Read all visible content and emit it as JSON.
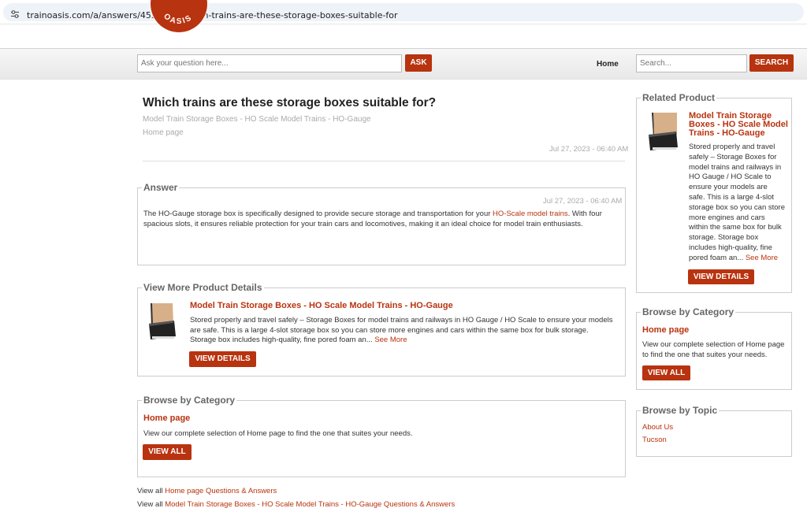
{
  "browser": {
    "url": "trainoasis.com/a/answers/4538511/Which-trains-are-these-storage-boxes-suitable-for"
  },
  "logo": {
    "text": "OASIS",
    "color": "#b8330f"
  },
  "header": {
    "ask_placeholder": "Ask your question here...",
    "ask_label": "ASK",
    "home_label": "Home",
    "search_placeholder": "Search...",
    "search_label": "SEARCH"
  },
  "question": {
    "title": "Which trains are these storage boxes suitable for",
    "title_suffix": "?",
    "breadcrumb": "Model Train Storage Boxes - HO Scale Model Trains - HO-Gauge",
    "home": "Home page",
    "date": "Jul 27, 2023 - 06:40 AM"
  },
  "answer": {
    "legend": "Answer",
    "date": "Jul 27, 2023 - 06:40 AM",
    "text_before": "The HO-Gauge storage box is specifically designed to provide secure storage and transportation for your ",
    "link": "HO-Scale model trains",
    "text_after": ". With four spacious slots, it ensures reliable protection for your train cars and locomotives, making it an ideal choice for model train enthusiasts."
  },
  "product_details": {
    "legend": "View More Product Details",
    "title": "Model Train Storage Boxes - HO Scale Model Trains - HO-Gauge",
    "description": "Stored properly and travel safely – Storage Boxes for model trains and railways in HO Gauge / HO Scale to ensure your models are safe. This is a large 4-slot storage box so you can store more engines and cars within the same box for bulk storage. Storage box includes high-quality, fine pored foam an...",
    "see_more": "See More",
    "button": "VIEW DETAILS"
  },
  "browse": {
    "legend": "Browse by Category",
    "heading": "Home page",
    "text": "View our complete selection of Home page to find the one that suites your needs.",
    "button": "VIEW ALL"
  },
  "view_all_links": {
    "prefix": "View all ",
    "link1": "Home page Questions & Answers",
    "link2": "Model Train Storage Boxes - HO Scale Model Trains - HO-Gauge Questions & Answers"
  },
  "sidebar": {
    "related": {
      "legend": "Related Product",
      "title": "Model Train Storage Boxes - HO Scale Model Trains - HO-Gauge",
      "description": "Stored properly and travel safely – Storage Boxes for model trains and railways in HO Gauge / HO Scale to ensure your models are safe. This is a large 4-slot storage box so you can store more engines and cars within the same box for bulk storage. Storage box includes high-quality, fine pored foam an...",
      "see_more": "See More",
      "button": "VIEW DETAILS"
    },
    "category": {
      "legend": "Browse by Category",
      "heading": "Home page",
      "text": "View our complete selection of Home page to find the one that suites your needs.",
      "button": "VIEW ALL"
    },
    "topic": {
      "legend": "Browse by Topic",
      "items": [
        "About Us",
        "Tucson"
      ]
    }
  },
  "colors": {
    "accent": "#b8330f",
    "muted_text": "#aaaaaa",
    "border": "#cccccc"
  }
}
